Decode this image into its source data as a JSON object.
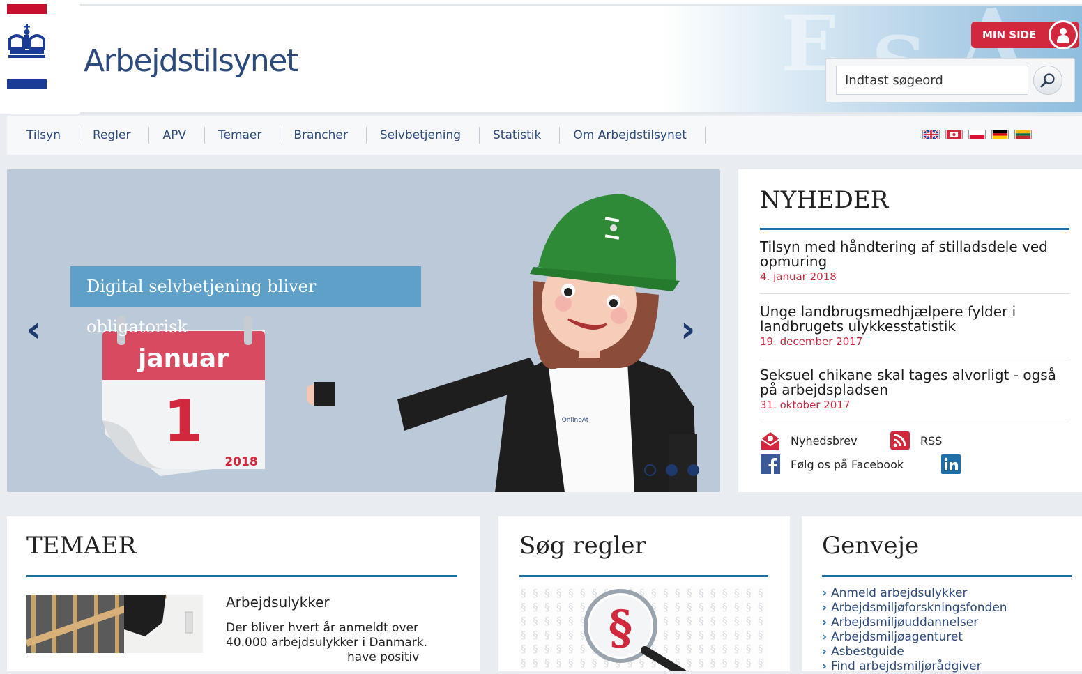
{
  "header": {
    "brand": "Arbejdstilsynet",
    "min_side_label": "MIN SIDE",
    "search_placeholder": "Indtast søgeord"
  },
  "nav": {
    "items": [
      "Tilsyn",
      "Regler",
      "APV",
      "Temaer",
      "Brancher",
      "Selvbetjening",
      "Statistik",
      "Om Arbejdstilsynet"
    ],
    "languages": [
      "english-flag-icon",
      "chinese-flag-icon",
      "polish-flag-icon",
      "german-flag-icon",
      "lithuanian-flag-icon"
    ]
  },
  "hero": {
    "caption": "Digital selvbetjening bliver obligatorisk",
    "calendar_month": "januar",
    "calendar_day": "1",
    "calendar_year": "2018",
    "shirt_text": "OnlineAt",
    "prev_arrow": "‹",
    "next_arrow": "›"
  },
  "news": {
    "title": "NYHEDER",
    "items": [
      {
        "headline": "Tilsyn med håndtering af stilladsdele ved opmuring",
        "date": "4. januar 2018"
      },
      {
        "headline": "Unge landbrugsmedhjælpere fylder i landbrugets ulykkesstatistik",
        "date": "19. december 2017"
      },
      {
        "headline": "Seksuel chikane skal tages alvorligt - også på arbejdspladsen",
        "date": "31. oktober 2017"
      }
    ],
    "newsletter_label": "Nyhedsbrev",
    "rss_label": "RSS",
    "facebook_label": "Følg os på Facebook"
  },
  "temaer": {
    "title": "TEMAER",
    "item_title": "Arbejdsulykker",
    "item_text": "Der bliver hvert år anmeldt over 40.000 arbejdsulykker i Danmark.",
    "item_text_overflow": "have positiv"
  },
  "sog_regler": {
    "title": "Søg regler"
  },
  "genveje": {
    "title": "Genveje",
    "links": [
      "Anmeld arbejdsulykker",
      "Arbejdsmiljøforskningsfonden",
      "Arbejdsmiljøuddannelser",
      "Arbejdsmiljøagenturet",
      "Asbestguide",
      "Find arbejdsmiljørådgiver"
    ]
  },
  "colors": {
    "brand_blue": "#2c4a7a",
    "accent_red": "#d1283d",
    "rule_blue": "#1e6ea7"
  }
}
